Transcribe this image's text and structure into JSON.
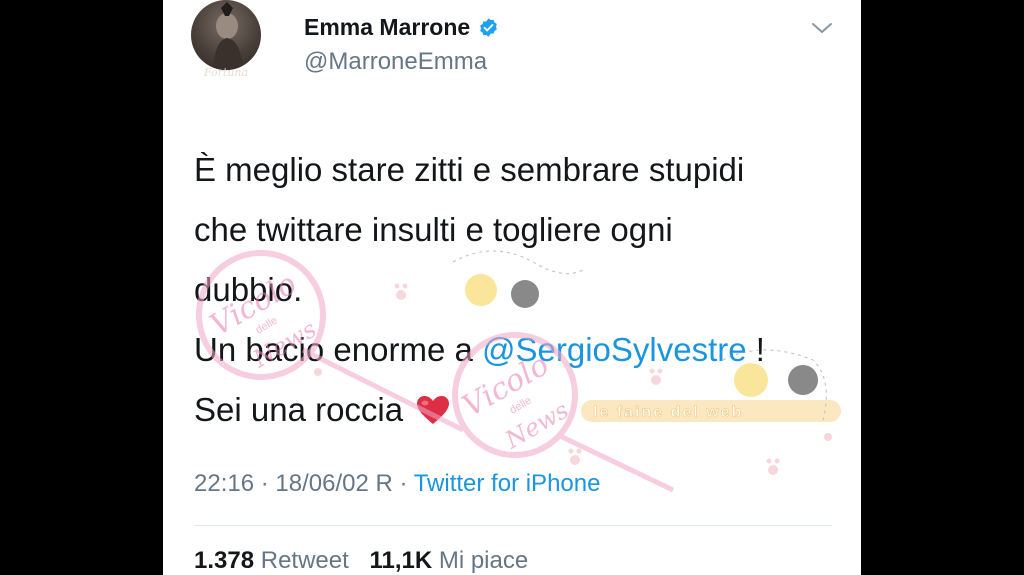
{
  "author": {
    "name": "Emma Marrone",
    "handle": "@MarroneEmma",
    "avatar_caption": "Fortuna",
    "verified": true
  },
  "tweet": {
    "line1": "È meglio stare zitti e sembrare stupidi",
    "line2": "che twittare insulti  e togliere ogni",
    "line3": "dubbio.",
    "line4_prefix": "Un bacio enorme a ",
    "mention": "@SergioSylvestre",
    "line4_suffix": " !",
    "line5": "Sei una roccia",
    "emoji": "red-heart"
  },
  "meta": {
    "time": "22:16 · 18/06/02 R · ",
    "source": "Twitter for iPhone"
  },
  "stats": {
    "retweets": "1.378",
    "retweets_label": "Retweet",
    "likes": "11,1K",
    "likes_label": "Mi piace"
  },
  "watermark": {
    "stamp1_script": "Vicolo",
    "stamp1_small": "delle",
    "stamp1_script2": "News",
    "stamp2_script": "Vicolo",
    "stamp2_small": "delle",
    "stamp2_script2": "News",
    "banner_text": "le faine del web"
  },
  "colors": {
    "link": "#1b95e0",
    "secondary": "#657786",
    "verified": "#1da1f2",
    "heart": "#dd2e44"
  }
}
